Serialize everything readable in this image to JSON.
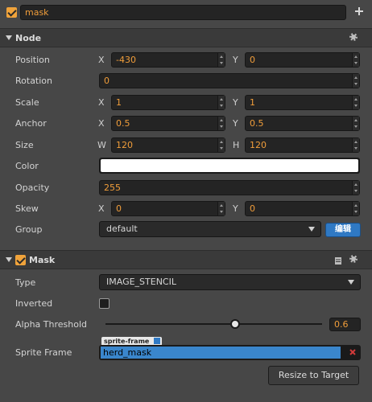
{
  "node_name": {
    "value": "mask",
    "active": true,
    "add_icon": "plus-icon"
  },
  "node_section": {
    "title": "Node",
    "position": {
      "label": "Position",
      "x_label": "X",
      "x": "-430",
      "y_label": "Y",
      "y": "0"
    },
    "rotation": {
      "label": "Rotation",
      "value": "0"
    },
    "scale": {
      "label": "Scale",
      "x_label": "X",
      "x": "1",
      "y_label": "Y",
      "y": "1"
    },
    "anchor": {
      "label": "Anchor",
      "x_label": "X",
      "x": "0.5",
      "y_label": "Y",
      "y": "0.5"
    },
    "size": {
      "label": "Size",
      "w_label": "W",
      "w": "120",
      "h_label": "H",
      "h": "120"
    },
    "color": {
      "label": "Color",
      "value": "#ffffff"
    },
    "opacity": {
      "label": "Opacity",
      "value": "255"
    },
    "skew": {
      "label": "Skew",
      "x_label": "X",
      "x": "0",
      "y_label": "Y",
      "y": "0"
    },
    "group": {
      "label": "Group",
      "value": "default",
      "edit_label": "编辑"
    }
  },
  "mask_section": {
    "title": "Mask",
    "enabled": true,
    "type": {
      "label": "Type",
      "value": "IMAGE_STENCIL"
    },
    "inverted": {
      "label": "Inverted",
      "checked": false
    },
    "alpha_threshold": {
      "label": "Alpha Threshold",
      "value": "0.6",
      "fraction": 0.6
    },
    "sprite_frame": {
      "label": "Sprite Frame",
      "tag": "sprite-frame",
      "value": "herd_mask"
    },
    "resize_button": "Resize to Target"
  },
  "colors": {
    "accent": "#f09d3a",
    "blue": "#2f79c4",
    "clear": "#d23a3a"
  }
}
